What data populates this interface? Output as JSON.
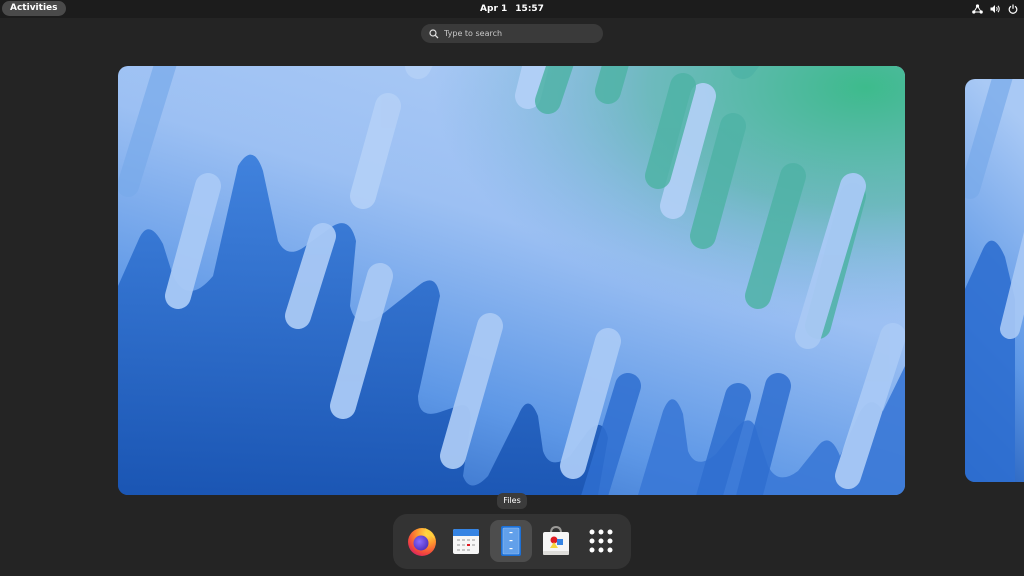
{
  "top_bar": {
    "activities_label": "Activities",
    "clock_date": "Apr 1",
    "clock_time": "15:57",
    "status_icons": [
      "network-icon",
      "volume-icon",
      "power-icon"
    ]
  },
  "search": {
    "placeholder": "Type to search"
  },
  "dash": {
    "tooltip": "Files",
    "items": [
      {
        "icon": "firefox-icon",
        "active": false
      },
      {
        "icon": "calendar-icon",
        "active": false
      },
      {
        "icon": "files-icon",
        "active": true
      },
      {
        "icon": "software-icon",
        "active": false
      },
      {
        "icon": "show-apps-icon",
        "active": false
      }
    ]
  },
  "colors": {
    "panel": "#1c1c1c",
    "background": "#242424",
    "dash": "#333333",
    "wallpaper_blue": "#2f6fd0",
    "wallpaper_light": "#9cc0f3",
    "wallpaper_green": "#3dbb8c"
  }
}
